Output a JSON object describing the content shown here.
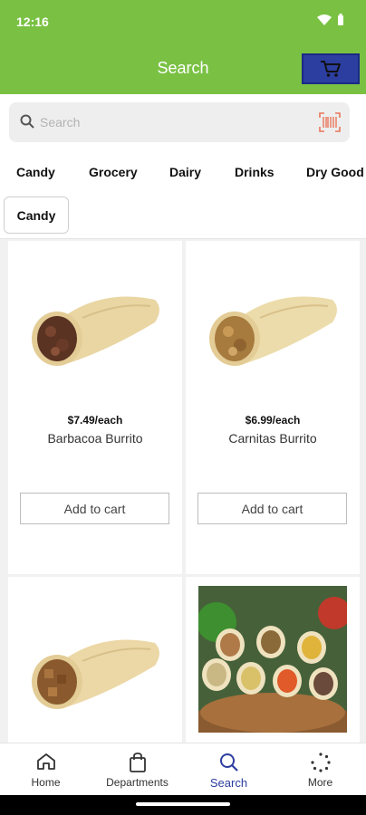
{
  "status": {
    "time": "12:16"
  },
  "header": {
    "title": "Search"
  },
  "search": {
    "placeholder": "Search"
  },
  "categories": [
    "Candy",
    "Grocery",
    "Dairy",
    "Drinks",
    "Dry Good"
  ],
  "selected_chip": "Candy",
  "products": [
    {
      "price": "$7.49/each",
      "name": "Barbacoa Burrito",
      "button": "Add to cart"
    },
    {
      "price": "$6.99/each",
      "name": "Carnitas Burrito",
      "button": "Add to cart"
    }
  ],
  "nav": [
    {
      "label": "Home",
      "icon": "home-icon"
    },
    {
      "label": "Departments",
      "icon": "bag-icon"
    },
    {
      "label": "Search",
      "icon": "search-icon"
    },
    {
      "label": "More",
      "icon": "more-icon"
    }
  ],
  "colors": {
    "header": "#7ac143",
    "accent": "#2c3ea0"
  }
}
